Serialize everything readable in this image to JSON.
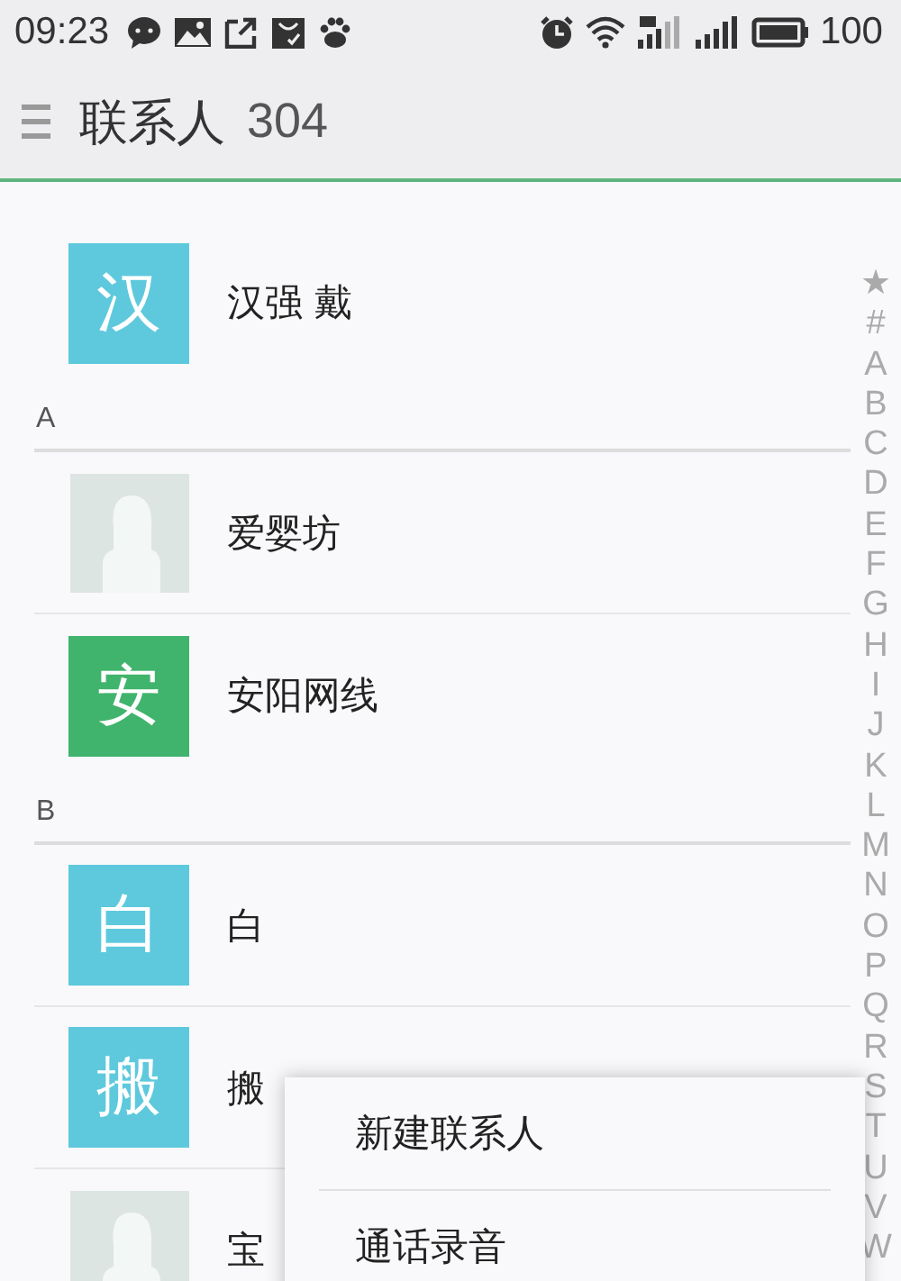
{
  "status_bar": {
    "time": "09:23",
    "battery": "100"
  },
  "header": {
    "title": "联系人",
    "count": "304"
  },
  "groups": [
    {
      "contacts": [
        {
          "name": "汉强 戴",
          "avatar": {
            "kind": "letter",
            "letter": "汉",
            "color": "#5ec9dd"
          }
        }
      ]
    },
    {
      "label": "A",
      "contacts": [
        {
          "name": "爱婴坊",
          "avatar": {
            "kind": "placeholder"
          }
        },
        {
          "name": "安阳网线",
          "avatar": {
            "kind": "letter",
            "letter": "安",
            "color": "#40b46c"
          }
        }
      ]
    },
    {
      "label": "B",
      "contacts": [
        {
          "name": "白",
          "avatar": {
            "kind": "letter",
            "letter": "白",
            "color": "#5ec9dd"
          }
        },
        {
          "name": "搬",
          "avatar": {
            "kind": "letter",
            "letter": "搬",
            "color": "#5ec9dd"
          }
        },
        {
          "name": "宝",
          "avatar": {
            "kind": "placeholder"
          }
        }
      ]
    }
  ],
  "index": [
    "★",
    "#",
    "A",
    "B",
    "C",
    "D",
    "E",
    "F",
    "G",
    "H",
    "I",
    "J",
    "K",
    "L",
    "M",
    "N",
    "O",
    "P",
    "Q",
    "R",
    "S",
    "T",
    "U",
    "V",
    "W"
  ],
  "menu": [
    "新建联系人",
    "通话录音"
  ]
}
